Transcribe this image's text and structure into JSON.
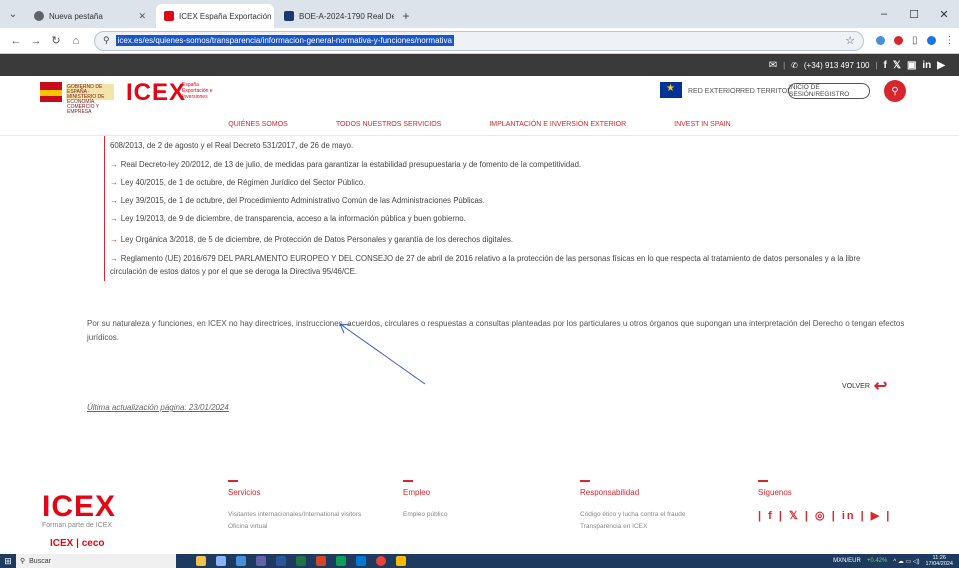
{
  "browser": {
    "tabs": [
      {
        "title": "Nueva pestaña",
        "favicon_color": "#5f6368",
        "active": false
      },
      {
        "title": "ICEX España Exportación e Inve",
        "favicon_color": "#e30613",
        "active": true
      },
      {
        "title": "BOE-A-2024-1790 Real Decreto",
        "favicon_color": "#1b3a6b",
        "active": false
      }
    ],
    "new_tab_label": "+",
    "url": "icex.es/es/quienes-somos/transparencia/informacion-general-normativa-y-funciones/normativa",
    "window_controls": [
      "–",
      "☐",
      "✕"
    ]
  },
  "topbar": {
    "phone": "(+34) 913 497 100",
    "social": [
      "f",
      "𝕏",
      "▣",
      "in",
      "▶"
    ]
  },
  "header": {
    "logo": "ICEX",
    "logo_sub": "España Exportación e Inversiones",
    "gov_text": "GOBIERNO DE ESPAÑA · MINISTERIO DE ECONOMÍA, COMERCIO Y EMPRESA",
    "red_exterior": "RED EXTERIOR",
    "red_territorial": "RED TERRITORIAL",
    "login": "INICIO DE SESIÓN/REGISTRO"
  },
  "nav": [
    "QUIÉNES SOMOS",
    "TODOS NUESTROS SERVICIOS",
    "IMPLANTACIÓN E INVERSIÓN EXTERIOR",
    "INVEST IN SPAIN"
  ],
  "content": {
    "cut_line": "608/2013, de 2 de agosto y el Real Decreto 531/2017, de 26 de mayo.",
    "laws": [
      "Real Decreto-ley 20/2012, de 13 de julio, de medidas para garantizar la estabilidad presupuestaria y de fomento de la competitividad.",
      "Ley 40/2015, de 1 de octubre, de Régimen Jurídico del Sector Público.",
      "Ley 39/2015, de 1 de octubre, del Procedimiento Administrativo Común de las Administraciones Públicas.",
      "Ley 19/2013, de 9 de diciembre, de transparencia, acceso a la información pública y buen gobierno.",
      "Ley Orgánica 3/2018, de 5 de diciembre, de Protección de Datos Personales y garantía de los derechos digitales."
    ],
    "reglamento_l1": "Reglamento (UE) 2016/679 DEL PARLAMENTO EUROPEO Y DEL CONSEJO de 27 de abril de 2016 relativo a la protección de las personas físicas en lo que respecta al tratamiento de datos personales y a la libre",
    "reglamento_l2": "circulación de estos datos y por el que se deroga la Directiva 95/46/CE.",
    "paragraph": "Por su naturaleza y funciones, en ICEX no hay directrices, instrucciones, acuerdos, circulares o respuestas a consultas planteadas por los particulares u otros órganos que supongan una interpretación del Derecho o tengan efectos jurídicos.",
    "volver": "VOLVER",
    "updated": "Última actualización página: 23/01/2024"
  },
  "footer": {
    "logo": "ICEX",
    "formar": "Forman parte de ICEX",
    "ceco": "ICEX | ceco",
    "columns": [
      {
        "heading": "Servicios",
        "items": [
          "Visitantes internacionales/International visitors",
          "Oficina virtual"
        ]
      },
      {
        "heading": "Empleo",
        "items": [
          "Empleo público"
        ]
      },
      {
        "heading": "Responsabilidad",
        "items": [
          "Código ético y lucha contra el fraude",
          "Transparencia en ICEX"
        ]
      },
      {
        "heading": "Síguenos",
        "items": []
      }
    ],
    "social": "| f | 𝕏 | ◎ | in | ▶ |"
  },
  "taskbar": {
    "search": "Buscar",
    "currency": "MXN/EUR",
    "change": "+0.42%",
    "time": "11:26",
    "date": "17/04/2024"
  }
}
